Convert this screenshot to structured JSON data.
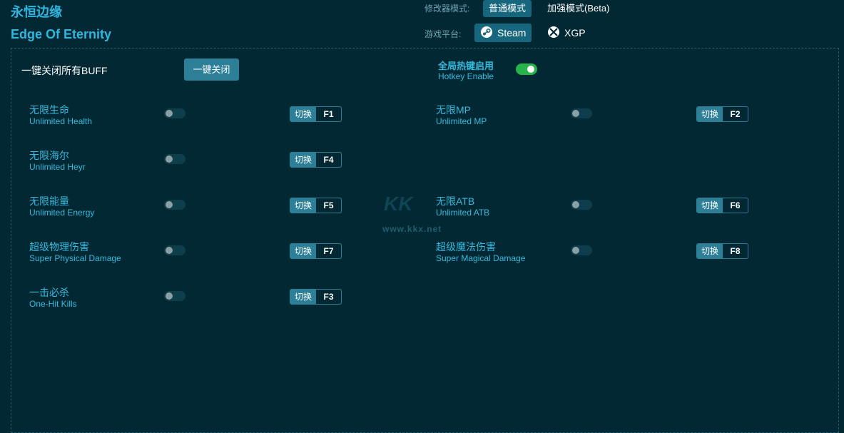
{
  "header": {
    "title_cn": "永恒边缘",
    "title_en": "Edge Of Eternity",
    "mode_label": "修改器模式:",
    "mode_normal": "普通模式",
    "mode_enhanced": "加强模式(Beta)",
    "platform_label": "游戏平台:",
    "platform_steam": "Steam",
    "platform_xgp": "XGP"
  },
  "controls": {
    "buff_label": "一键关闭所有BUFF",
    "close_button": "一键关闭",
    "hotkey_cn": "全局热键启用",
    "hotkey_en": "Hotkey Enable",
    "hotkey_enabled": true
  },
  "switch_label": "切换",
  "options": [
    {
      "cn": "无限生命",
      "en": "Unlimited Health",
      "key": "F1",
      "enabled": false
    },
    {
      "cn": "无限MP",
      "en": "Unlimited MP",
      "key": "F2",
      "enabled": false
    },
    {
      "cn": "无限海尔",
      "en": "Unlimited Heyr",
      "key": "F4",
      "enabled": false
    },
    {
      "cn": "无限能量",
      "en": "Unlimited Energy",
      "key": "F5",
      "enabled": false
    },
    {
      "cn": "无限ATB",
      "en": "Unlimited ATB",
      "key": "F6",
      "enabled": false
    },
    {
      "cn": "超级物理伤害",
      "en": "Super Physical Damage",
      "key": "F7",
      "enabled": false
    },
    {
      "cn": "超级魔法伤害",
      "en": "Super Magical Damage",
      "key": "F8",
      "enabled": false
    },
    {
      "cn": "一击必杀",
      "en": "One-Hit Kills",
      "key": "F3",
      "enabled": false
    }
  ],
  "watermark": {
    "logo": "KK",
    "url": "www.kkx.net"
  }
}
